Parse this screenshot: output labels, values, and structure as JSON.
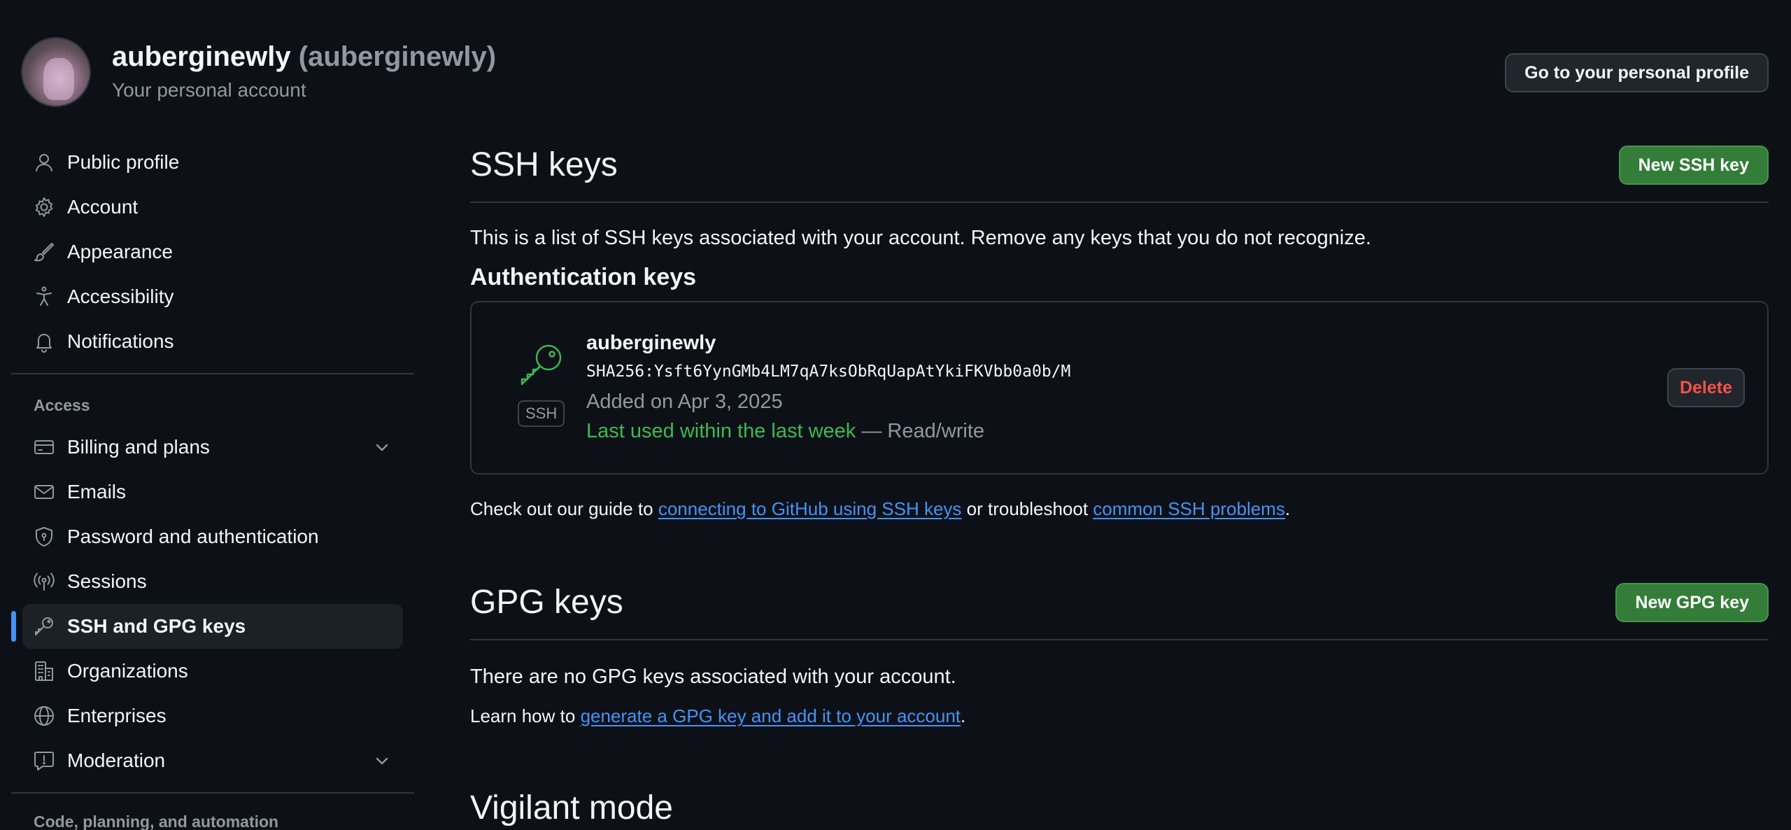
{
  "header": {
    "name": "auberginewly",
    "login": "(auberginewly)",
    "subtitle": "Your personal account",
    "profile_button": "Go to your personal profile"
  },
  "sidebar": {
    "items_top": [
      {
        "label": "Public profile",
        "icon": "person-icon"
      },
      {
        "label": "Account",
        "icon": "gear-icon"
      },
      {
        "label": "Appearance",
        "icon": "paintbrush-icon"
      },
      {
        "label": "Accessibility",
        "icon": "accessibility-icon"
      },
      {
        "label": "Notifications",
        "icon": "bell-icon"
      }
    ],
    "access_label": "Access",
    "items_access": [
      {
        "label": "Billing and plans",
        "icon": "credit-card-icon",
        "expandable": true
      },
      {
        "label": "Emails",
        "icon": "mail-icon"
      },
      {
        "label": "Password and authentication",
        "icon": "shield-icon"
      },
      {
        "label": "Sessions",
        "icon": "broadcast-icon"
      },
      {
        "label": "SSH and GPG keys",
        "icon": "key-icon",
        "active": true
      },
      {
        "label": "Organizations",
        "icon": "organization-icon"
      },
      {
        "label": "Enterprises",
        "icon": "globe-icon"
      },
      {
        "label": "Moderation",
        "icon": "report-icon",
        "expandable": true
      }
    ],
    "next_section_label": "Code, planning, and automation"
  },
  "ssh": {
    "title": "SSH keys",
    "new_button": "New SSH key",
    "description": "This is a list of SSH keys associated with your account. Remove any keys that you do not recognize.",
    "auth_heading": "Authentication keys",
    "key": {
      "badge": "SSH",
      "title": "auberginewly",
      "fingerprint": "SHA256:Ysft6YynGMb4LM7qA7ksObRqUapAtYkiFKVbb0a0b/M",
      "added": "Added on Apr 3, 2025",
      "last_used": "Last used within the last week",
      "access": " — Read/write",
      "delete_button": "Delete"
    },
    "guide_prefix": "Check out our guide to ",
    "guide_link": "connecting to GitHub using SSH keys",
    "guide_middle": " or troubleshoot ",
    "guide_link2": "common SSH problems",
    "guide_suffix": "."
  },
  "gpg": {
    "title": "GPG keys",
    "new_button": "New GPG key",
    "empty_text": "There are no GPG keys associated with your account.",
    "learn_prefix": "Learn how to ",
    "learn_link": "generate a GPG key and add it to your account",
    "learn_suffix": "."
  },
  "vigilant": {
    "title": "Vigilant mode"
  },
  "colors": {
    "background": "#0d1117",
    "accent": "#4493f8",
    "success": "#3fb950",
    "danger": "#f85149",
    "primary_button": "#347d39"
  }
}
